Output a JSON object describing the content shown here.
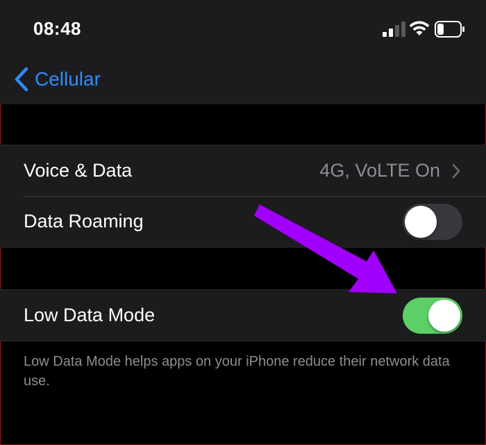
{
  "status_bar": {
    "time": "08:48",
    "icons": [
      "signal-icon",
      "wifi-icon",
      "battery-icon"
    ]
  },
  "nav": {
    "back_label": "Cellular",
    "back_icon": "chevron-left-icon"
  },
  "groups": {
    "first": {
      "rows": [
        {
          "label": "Voice & Data",
          "value": "4G, VoLTE On",
          "accessory": "chevron-right-icon"
        },
        {
          "label": "Data Roaming",
          "toggle_on": false
        }
      ]
    },
    "second": {
      "rows": [
        {
          "label": "Low Data Mode",
          "toggle_on": true
        }
      ],
      "footer": "Low Data Mode helps apps on your iPhone reduce their network data use."
    }
  },
  "colors": {
    "background": "#000000",
    "cell_background": "#1c1c1e",
    "accent_blue": "#2f8cff",
    "toggle_on": "#5ccf66",
    "toggle_off": "#39393d",
    "secondary_text": "#8e8e93",
    "annotation_arrow": "#a100ff"
  },
  "annotation": {
    "arrow_icon": "pointer-arrow-icon",
    "points_to": "Low Data Mode toggle"
  }
}
